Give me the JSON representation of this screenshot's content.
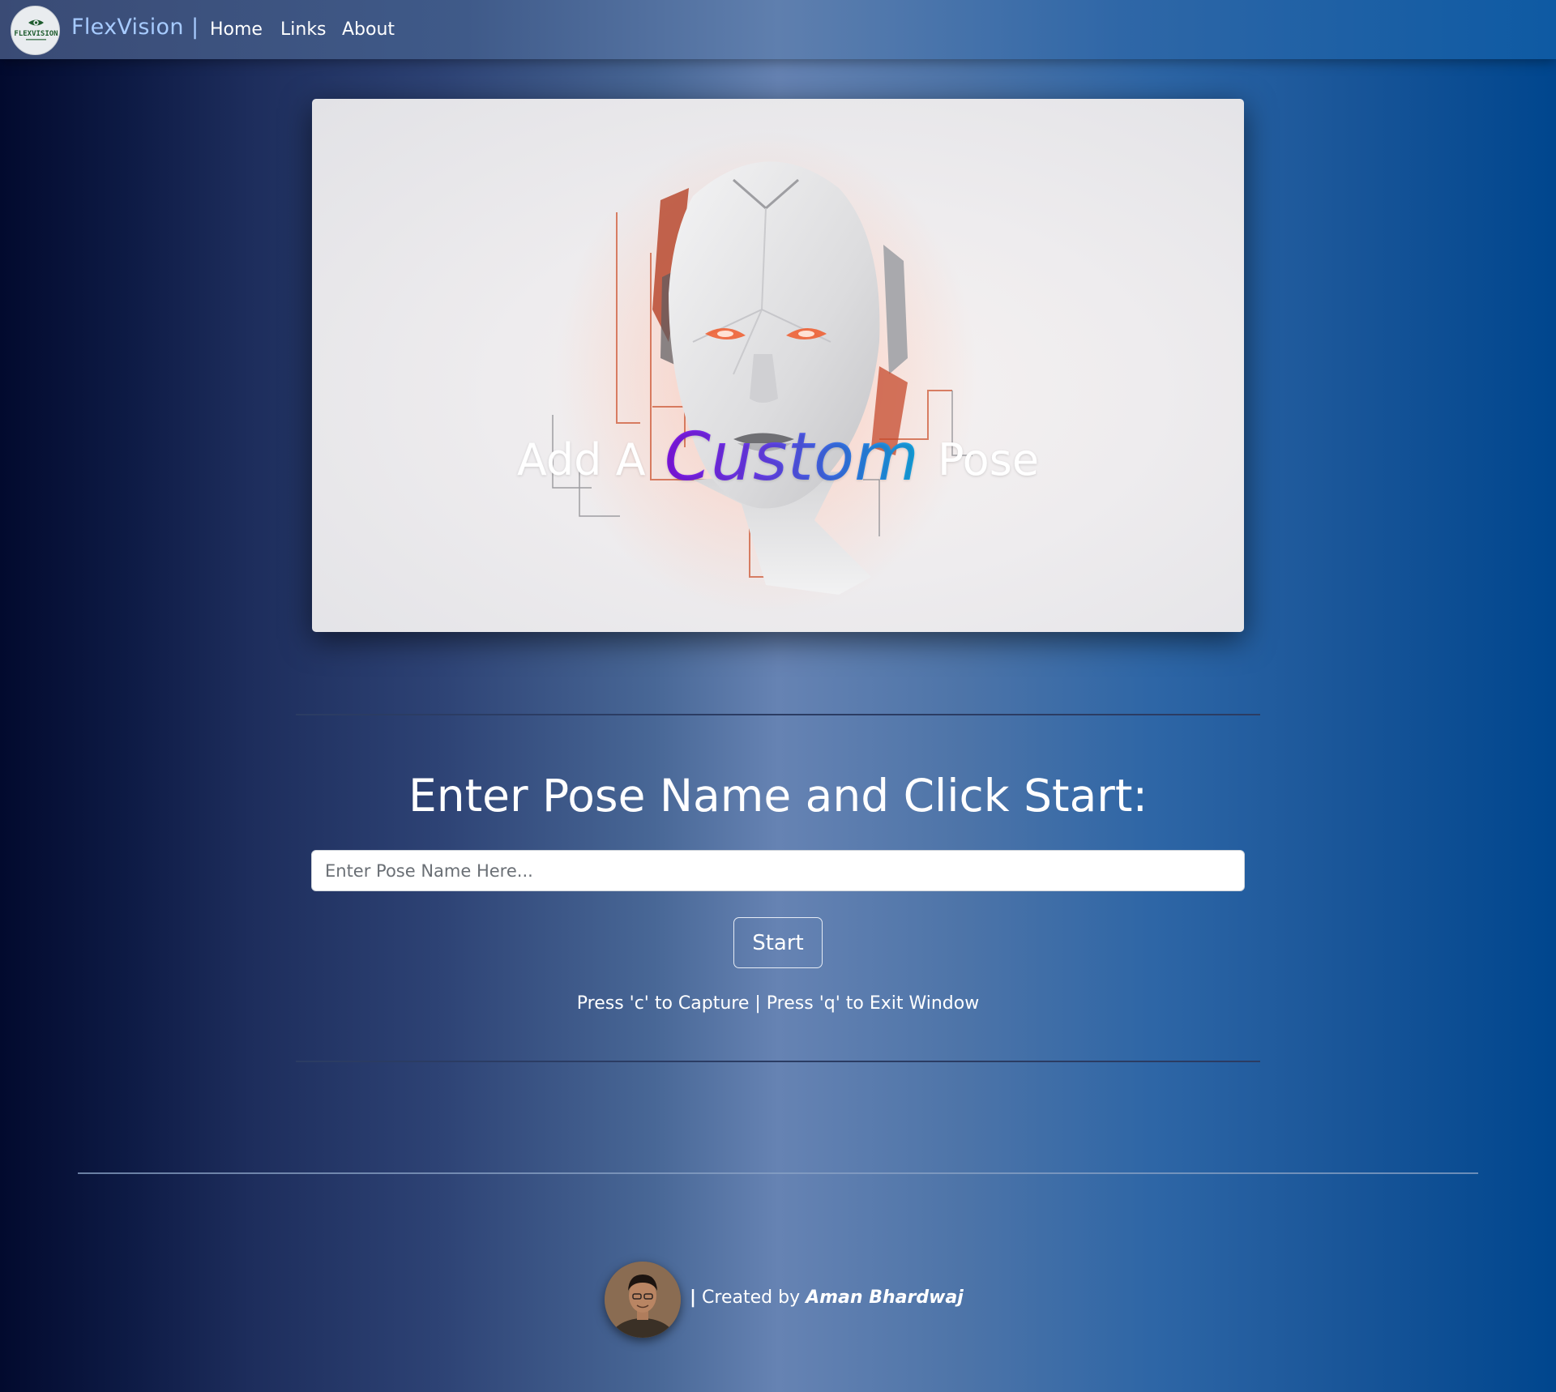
{
  "navbar": {
    "brand": "FlexVision",
    "separator": "|",
    "links": [
      "Home",
      "Links",
      "About"
    ],
    "logo_text": "FLEXVISION"
  },
  "hero": {
    "title_prefix": "Add A",
    "title_highlight": "Custom",
    "title_suffix": "Pose"
  },
  "form": {
    "heading": "Enter Pose Name and Click Start:",
    "input_placeholder": "Enter Pose Name Here...",
    "start_label": "Start",
    "hint": "Press 'c' to Capture | Press 'q' to Exit Window"
  },
  "footer": {
    "separator": "|",
    "created_by": "Created by",
    "author": "Aman Bhardwaj"
  },
  "colors": {
    "brand": "#a7cbff",
    "custom_gradient_start": "#8a14f2",
    "custom_gradient_end": "#13b3ee"
  }
}
